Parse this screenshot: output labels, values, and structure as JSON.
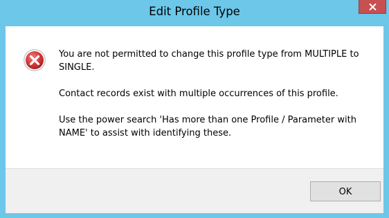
{
  "window": {
    "title": "Edit Profile Type",
    "close_icon": "close-icon"
  },
  "dialog": {
    "icon": "error-icon",
    "message_lines": [
      "You are not permitted to change this profile type from MULTIPLE to SINGLE.",
      "Contact records exist with multiple occurrences of this profile.",
      "Use the power search 'Has more than one Profile / Parameter with NAME' to assist with identifying these."
    ],
    "ok_label": "OK"
  },
  "colors": {
    "titlebar": "#6cc7e9",
    "close_button": "#c75050",
    "error_red": "#d63b3b",
    "button_area": "#f0f0f0"
  }
}
